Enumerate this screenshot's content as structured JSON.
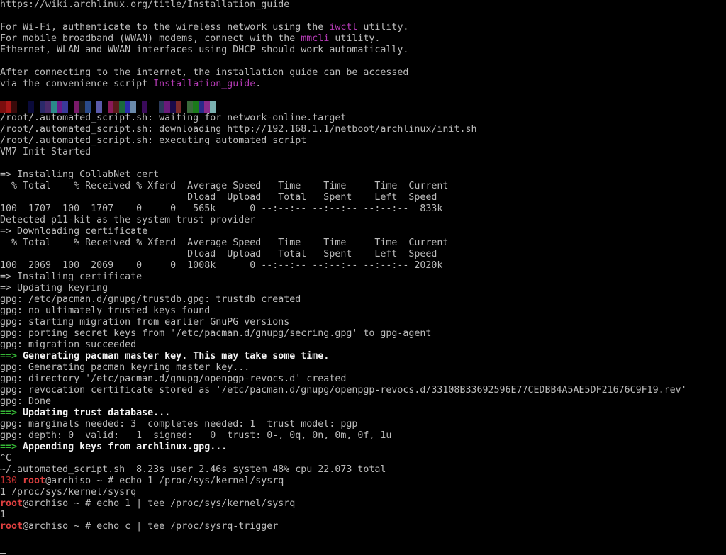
{
  "colors": {
    "background": "#000000",
    "foreground": "#bcbcbc",
    "bold": "#f2f2f2",
    "magenta": "#b23ab2",
    "red": "#c23030",
    "bright_red": "#e04040",
    "green": "#36b636",
    "cursor": "#bcbcbc"
  },
  "terminal": {
    "lines": [
      [
        [
          "normal",
          "https://wiki.archlinux.org/title/Installation_guide"
        ]
      ],
      [],
      [
        [
          "normal",
          "For Wi-Fi, authenticate to the wireless network using the "
        ],
        [
          "magenta",
          "iwctl"
        ],
        [
          "normal",
          " utility."
        ]
      ],
      [
        [
          "normal",
          "For mobile broadband (WWAN) modems, connect with the "
        ],
        [
          "magenta",
          "mmcli"
        ],
        [
          "normal",
          " utility."
        ]
      ],
      [
        [
          "normal",
          "Ethernet, WLAN and WWAN interfaces using DHCP should work automatically."
        ]
      ],
      [],
      [
        [
          "normal",
          "After connecting to the internet, the installation guide can be accessed"
        ]
      ],
      [
        [
          "normal",
          "via the convenience script "
        ],
        [
          "magenta",
          "Installation_guide"
        ],
        [
          "normal",
          "."
        ]
      ],
      [],
      {
        "colorbar": [
          "#7a0e0e",
          "#a81616",
          "#3a0a0a",
          "#000000",
          "#000000",
          "#0a0a3a",
          "#000000",
          "#2a2a6a",
          "#4a2a6a",
          "#2a8a8a",
          "#6a1a8a",
          "#3a3a9a",
          "#000000",
          "#7a1a6a",
          "#1a1a1a",
          "#2a4a8a",
          "#000000",
          "#5a5aaa",
          "#000000",
          "#8a1a5a",
          "#5a1a1a",
          "#1a6a3a",
          "#2a2aaa",
          "#6a8aaa",
          "#000000",
          "#3a0a5a",
          "#000000",
          "#000000",
          "#2a3a5a",
          "#6a1a7a",
          "#1a0a4a",
          "#7a2a2a",
          "#000000",
          "#3a6a3a",
          "#1a7a1a",
          "#2a2a8a",
          "#8a2a8a",
          "#7ab0b0",
          "#000000",
          "#000000",
          "#000000",
          "#000000"
        ]
      },
      [
        [
          "normal",
          "/root/.automated_script.sh: waiting for network-online.target"
        ]
      ],
      [
        [
          "normal",
          "/root/.automated_script.sh: downloading http://192.168.1.1/netboot/archlinux/init.sh"
        ]
      ],
      [
        [
          "normal",
          "/root/.automated_script.sh: executing automated script"
        ]
      ],
      [
        [
          "normal",
          "VM7 Init Started"
        ]
      ],
      [],
      [
        [
          "normal",
          "=> Installing CollabNet cert"
        ]
      ],
      [
        [
          "normal",
          "  % Total    % Received % Xferd  Average Speed   Time    Time     Time  Current"
        ]
      ],
      [
        [
          "normal",
          "                                 Dload  Upload   Total   Spent    Left  Speed"
        ]
      ],
      [
        [
          "normal",
          "100  1707  100  1707    0     0   565k      0 --:--:-- --:--:-- --:--:--  833k"
        ]
      ],
      [
        [
          "normal",
          "Detected p11-kit as the system trust provider"
        ]
      ],
      [
        [
          "normal",
          "=> Downloading certificate"
        ]
      ],
      [
        [
          "normal",
          "  % Total    % Received % Xferd  Average Speed   Time    Time     Time  Current"
        ]
      ],
      [
        [
          "normal",
          "                                 Dload  Upload   Total   Spent    Left  Speed"
        ]
      ],
      [
        [
          "normal",
          "100  2069  100  2069    0     0  1008k      0 --:--:-- --:--:-- --:--:-- 2020k"
        ]
      ],
      [
        [
          "normal",
          "=> Installing certificate"
        ]
      ],
      [
        [
          "normal",
          "=> Updating keyring"
        ]
      ],
      [
        [
          "normal",
          "gpg: /etc/pacman.d/gnupg/trustdb.gpg: trustdb created"
        ]
      ],
      [
        [
          "normal",
          "gpg: no ultimately trusted keys found"
        ]
      ],
      [
        [
          "normal",
          "gpg: starting migration from earlier GnuPG versions"
        ]
      ],
      [
        [
          "normal",
          "gpg: porting secret keys from '/etc/pacman.d/gnupg/secring.gpg' to gpg-agent"
        ]
      ],
      [
        [
          "normal",
          "gpg: migration succeeded"
        ]
      ],
      [
        [
          "green",
          "==>"
        ],
        [
          "bold",
          " Generating pacman master key. This may take some time."
        ]
      ],
      [
        [
          "normal",
          "gpg: Generating pacman keyring master key..."
        ]
      ],
      [
        [
          "normal",
          "gpg: directory '/etc/pacman.d/gnupg/openpgp-revocs.d' created"
        ]
      ],
      [
        [
          "normal",
          "gpg: revocation certificate stored as '/etc/pacman.d/gnupg/openpgp-revocs.d/33108B33692596E77CEDBB4A5AE5DF21676C9F19.rev'"
        ]
      ],
      [
        [
          "normal",
          "gpg: Done"
        ]
      ],
      [
        [
          "green",
          "==>"
        ],
        [
          "bold",
          " Updating trust database..."
        ]
      ],
      [
        [
          "normal",
          "gpg: marginals needed: 3  completes needed: 1  trust model: pgp"
        ]
      ],
      [
        [
          "normal",
          "gpg: depth: 0  valid:   1  signed:   0  trust: 0-, 0q, 0n, 0m, 0f, 1u"
        ]
      ],
      [
        [
          "green",
          "==>"
        ],
        [
          "bold",
          " Appending keys from archlinux.gpg..."
        ]
      ],
      [
        [
          "normal",
          "^C"
        ]
      ],
      [
        [
          "normal",
          "~/.automated_script.sh  8.23s user 2.46s system 48% cpu 22.073 total"
        ]
      ],
      [
        [
          "red",
          "130 "
        ],
        [
          "bred",
          "root"
        ],
        [
          "normal",
          "@archiso ~ # echo 1 /proc/sys/kernel/sysrq"
        ]
      ],
      [
        [
          "normal",
          "1 /proc/sys/kernel/sysrq"
        ]
      ],
      [
        [
          "bred",
          "root"
        ],
        [
          "normal",
          "@archiso ~ # echo 1 | tee /proc/sys/kernel/sysrq"
        ]
      ],
      [
        [
          "normal",
          "1"
        ]
      ],
      [
        [
          "bred",
          "root"
        ],
        [
          "normal",
          "@archiso ~ # echo c | tee /proc/sysrq-trigger"
        ]
      ],
      [],
      {
        "cursor": true
      }
    ]
  }
}
